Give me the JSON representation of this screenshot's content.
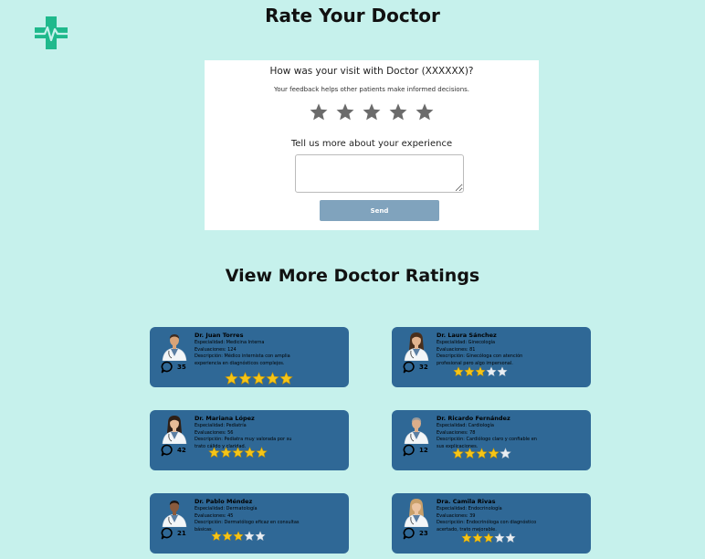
{
  "header": {
    "title": "Rate Your Doctor"
  },
  "rating_form": {
    "question": "How was your visit with Doctor (XXXXXX)?",
    "subtitle": "Your feedback helps other patients make informed decisions.",
    "star_count": 5,
    "details_label": "Tell us more about your experience",
    "feedback_value": "",
    "send_label": "Send"
  },
  "ratings_section": {
    "title": "View More Doctor Ratings",
    "doctors": [
      {
        "name": "Dr. Juan Torres",
        "specialty": "Especialidad: Medicina Interna",
        "evaluations": "Evaluaciones: 124",
        "description": "Descripción: Médico internista con amplia experiencia en diagnósticos complejos.",
        "comments": "35",
        "rating": 5,
        "gender": "male",
        "skin": "#d9a478",
        "hair": "#3b2a20"
      },
      {
        "name": "Dr. Laura Sánchez",
        "specialty": "Especialidad: Ginecología",
        "evaluations": "Evaluaciones: 81",
        "description": "Descripción: Ginecóloga con atención profesional pero algo impersonal.",
        "comments": "32",
        "rating": 3,
        "gender": "female",
        "skin": "#e3b48f",
        "hair": "#4a2f1c"
      },
      {
        "name": "Dr. Mariana López",
        "specialty": "Especialidad: Pediatría",
        "evaluations": "Evaluaciones: 56",
        "description": "Descripción: Pediatra muy valorada por su trato cálido y claridad.",
        "comments": "42",
        "rating": 5,
        "gender": "female",
        "skin": "#e6bb97",
        "hair": "#2e1f16"
      },
      {
        "name": "Dr. Ricardo Fernández",
        "specialty": "Especialidad: Cardiología",
        "evaluations": "Evaluaciones: 78",
        "description": "Descripción: Cardiólogo claro y confiable en sus explicaciones.",
        "comments": "12",
        "rating": 4,
        "gender": "male",
        "skin": "#dcae8a",
        "hair": "#9a9a9a"
      },
      {
        "name": "Dr. Pablo Méndez",
        "specialty": "Especialidad: Dermatología",
        "evaluations": "Evaluaciones: 45",
        "description": "Descripción: Dermatólogo eficaz en consultas básicas.",
        "comments": "21",
        "rating": 3,
        "gender": "male",
        "skin": "#8a5a3c",
        "hair": "#1d1410"
      },
      {
        "name": "Dra. Camila Rivas",
        "specialty": "Especialidad: Endocrinología",
        "evaluations": "Evaluaciones: 39",
        "description": "Descripción: Endocrinóloga con diagnóstico acertado, trato mejorable.",
        "comments": "23",
        "rating": 3,
        "gender": "female",
        "skin": "#ecc4a2",
        "hair": "#c9a06a"
      }
    ]
  },
  "colors": {
    "background": "#c6f1ec",
    "card": "#2f6896",
    "send_button": "#80a3bd",
    "star_gold": "#f5c518",
    "star_empty": "#e9eef3",
    "star_form": "#6b6b6b",
    "logo": "#1fb98c"
  },
  "icons": {
    "logo": "medical-cross-heartbeat-icon",
    "form_star": "star-icon",
    "comment": "comment-bubble-icon"
  }
}
